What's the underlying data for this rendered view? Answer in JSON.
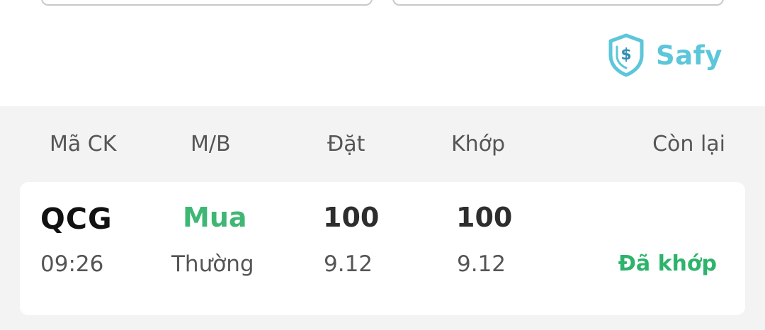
{
  "brand": {
    "name": "Safy",
    "icon": "shield-dollar-icon",
    "color": "#5cc6da"
  },
  "table": {
    "headers": {
      "symbol": "Mã CK",
      "side": "M/B",
      "order": "Đặt",
      "matched": "Khớp",
      "remaining": "Còn lại"
    },
    "rows": [
      {
        "symbol": "QCG",
        "side": "Mua",
        "order_qty": "100",
        "matched_qty": "100",
        "time": "09:26",
        "order_type": "Thường",
        "order_price": "9.12",
        "matched_price": "9.12",
        "status": "Đã khớp"
      }
    ]
  },
  "colors": {
    "buy": "#3fb774",
    "status_matched": "#2db36b",
    "background": "#f3f3f3"
  }
}
